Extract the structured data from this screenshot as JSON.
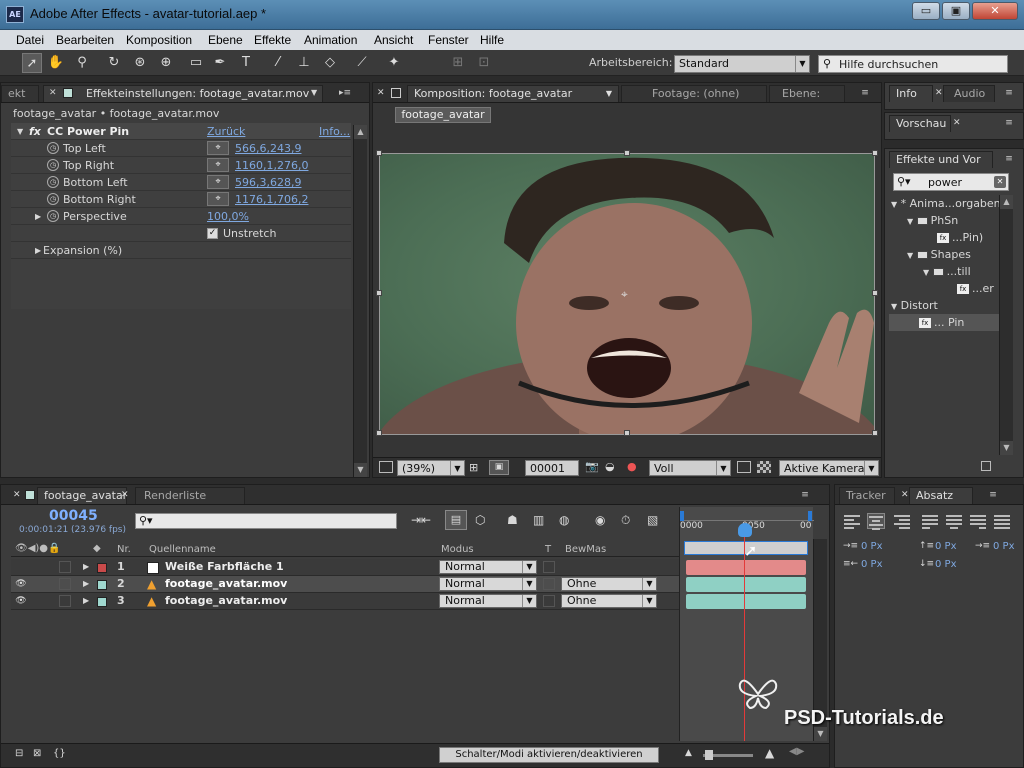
{
  "titlebar": {
    "logo": "AE",
    "title": "Adobe After Effects - avatar-tutorial.aep *",
    "minimize": "▭",
    "maximize": "▣",
    "close": "✕"
  },
  "menu": [
    "Datei",
    "Bearbeiten",
    "Komposition",
    "Ebene",
    "Effekte",
    "Animation",
    "Ansicht",
    "Fenster",
    "Hilfe"
  ],
  "toolbar": {
    "workspace_label": "Arbeitsbereich:",
    "workspace_value": "Standard",
    "help_placeholder": "Hilfe durchsuchen"
  },
  "effects_panel": {
    "tab_left": "ekt",
    "tab_title": "Effekteinstellungen: footage_avatar.mov",
    "breadcrumb": "footage_avatar • footage_avatar.mov",
    "effect_name": "CC Power Pin",
    "reset": "Zurück",
    "info": "Info...",
    "properties": [
      {
        "name": "Top Left",
        "value": "566,6,243,9"
      },
      {
        "name": "Top Right",
        "value": "1160,1,276,0"
      },
      {
        "name": "Bottom Left",
        "value": "596,3,628,9"
      },
      {
        "name": "Bottom Right",
        "value": "1176,1,706,2"
      }
    ],
    "perspective_label": "Perspective",
    "perspective_value": "100,0%",
    "unstretch_label": "Unstretch",
    "expansion_label": "Expansion (%)"
  },
  "comp_panel": {
    "tab_comp": "Komposition: footage_avatar",
    "tab_footage": "Footage: (ohne)",
    "tab_layer": "Ebene:",
    "comp_button": "footage_avatar",
    "zoom": "(39%)",
    "timecode": "00001",
    "resolution": "Voll",
    "camera": "Aktive Kamera"
  },
  "right_panels": {
    "info_tab": "Info",
    "audio_tab": "Audio",
    "preview_tab": "Vorschau",
    "effects_tab": "Effekte und Vor",
    "search_value": "power",
    "tree": [
      {
        "label": "* Anima...orgaben"
      },
      {
        "label": "PhSn"
      },
      {
        "label": "...Pin)"
      },
      {
        "label": "Shapes"
      },
      {
        "label": "...till"
      },
      {
        "label": "...er"
      },
      {
        "label": "Distort"
      },
      {
        "label": "... Pin"
      }
    ]
  },
  "timeline": {
    "tab_comp": "footage_avatar",
    "tab_render": "Renderliste",
    "timecode": "00045",
    "timecode_sub": "0:00:01:21 (23.976 fps)",
    "col_nr": "Nr.",
    "col_source": "Quellenname",
    "col_mode": "Modus",
    "col_t": "T",
    "col_trkmat": "BewMas",
    "ruler_start": "0000",
    "ruler_mid": "0050",
    "ruler_end": "00",
    "layers": [
      {
        "nr": "1",
        "name": "Weiße Farbfläche 1",
        "mode": "Normal",
        "trkmat": "",
        "color": "#c94a4a"
      },
      {
        "nr": "2",
        "name": "footage_avatar.mov",
        "mode": "Normal",
        "trkmat": "Ohne",
        "color": "#9fd8cf"
      },
      {
        "nr": "3",
        "name": "footage_avatar.mov",
        "mode": "Normal",
        "trkmat": "Ohne",
        "color": "#9fd8cf"
      }
    ],
    "toggle_button": "Schalter/Modi aktivieren/deaktivieren"
  },
  "paragraph_panel": {
    "tracker_tab": "Tracker",
    "absatz_tab": "Absatz",
    "indent_values": [
      "0 Px",
      "0 Px",
      "0 Px",
      "0 Px",
      "0 Px"
    ]
  },
  "watermark": "PSD-Tutorials.de",
  "colors": {
    "accent_link": "#7fa8e0",
    "playhead": "#e33a3a",
    "titlebar": "#4a7ea8"
  }
}
